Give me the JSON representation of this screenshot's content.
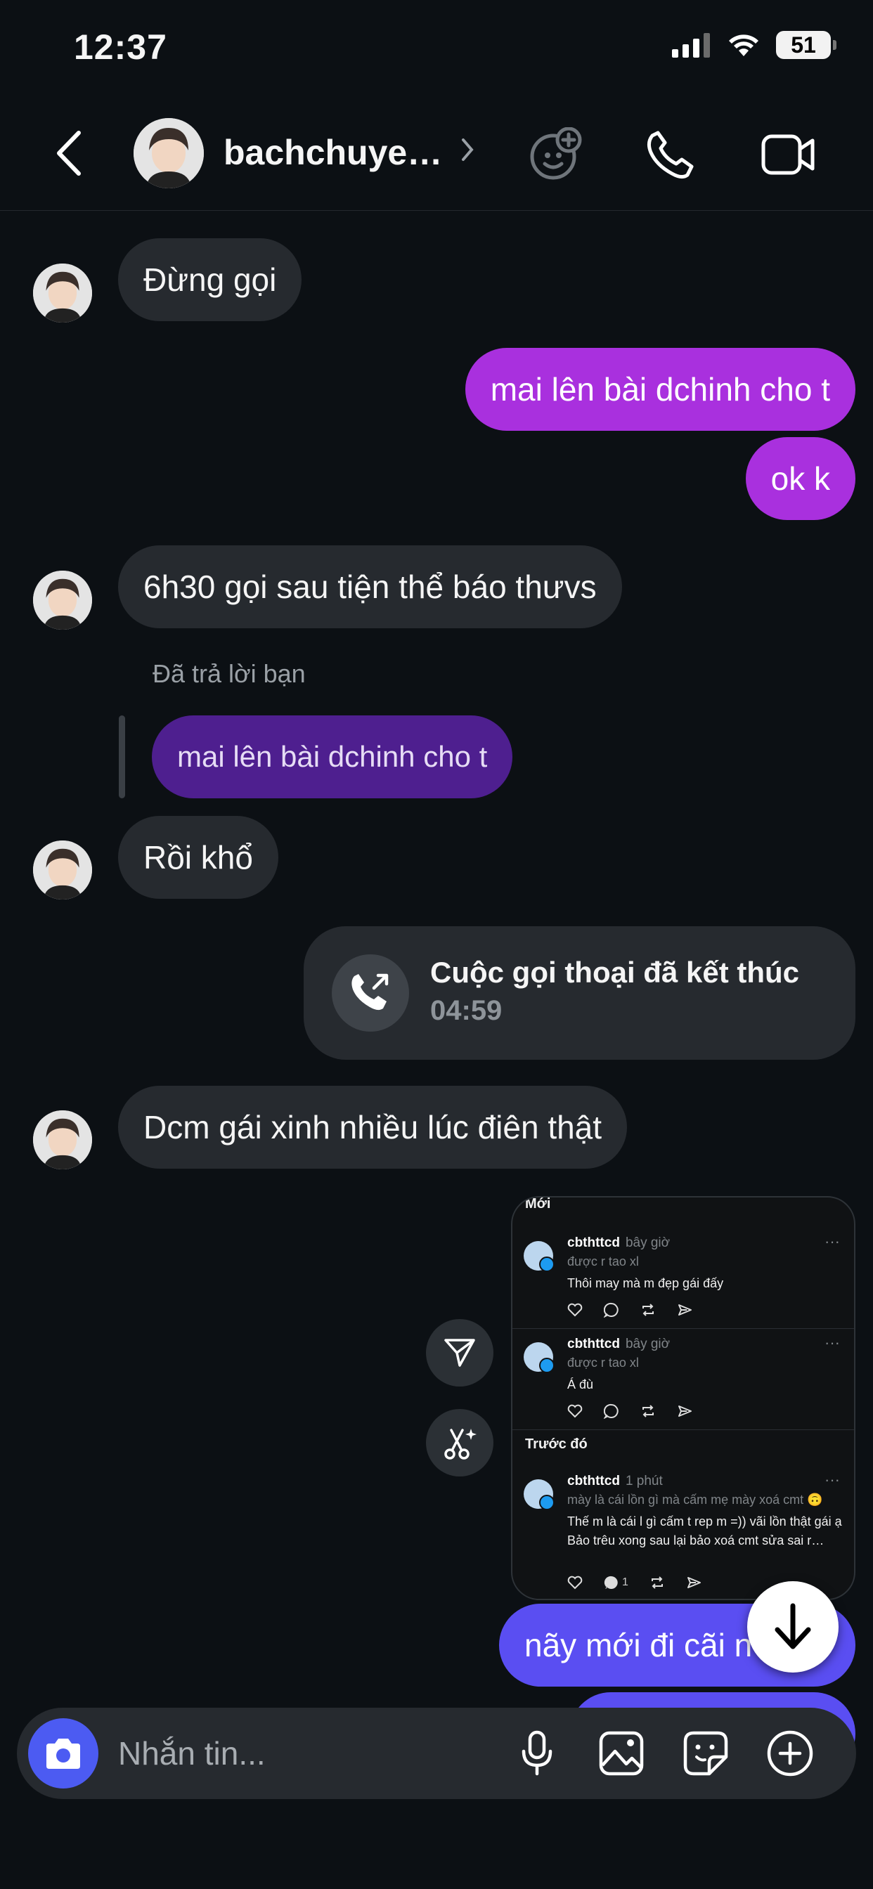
{
  "status_bar": {
    "time": "12:37",
    "battery": "51"
  },
  "header": {
    "name": "bachchuye…"
  },
  "messages": {
    "m1": "Đừng gọi",
    "m2": "mai lên bài dchinh cho t",
    "m3": "ok k",
    "m4": "6h30 gọi sau tiện thể báo thưvs",
    "reply_label": "Đã trả lời bạn",
    "m5_quoted": "mai lên bài dchinh cho t",
    "m6": "Rồi khổ",
    "m8": "Dcm gái xinh nhiều lúc điên thật",
    "m10": "nãy mới đi cãi n"
  },
  "call": {
    "title": "Cuộc gọi thoại đã kết thúc",
    "duration": "04:59"
  },
  "shared_card": {
    "heading_new": "Mới",
    "heading_before": "Trước đó",
    "posts": [
      {
        "user": "cbthttcd",
        "time": "bây giờ",
        "reply_to": "được r tao xl",
        "text": "Thôi may mà m đẹp gái đấy",
        "reply_count": ""
      },
      {
        "user": "cbthttcd",
        "time": "bây giờ",
        "reply_to": "được r tao xl",
        "text": "Á đù",
        "reply_count": ""
      },
      {
        "user": "cbthttcd",
        "time": "1 phút",
        "reply_to": "mày là cái lồn gì mà cấm mẹ mày xoá cmt 🙃",
        "text": "Thế m là cái l gì cấm t rep m =)) vãi lồn thật gái ạ\nBảo trêu xong sau lại bảo xoá cmt sửa sai r…",
        "reply_count": "1"
      }
    ]
  },
  "composer": {
    "placeholder": "Nhắn tin..."
  },
  "colors": {
    "outgoing_purple": "#a930de",
    "outgoing_blue": "#5a4ef2",
    "incoming": "#262a2f",
    "camera_button": "#4c5bf2"
  },
  "icons": {
    "back": "chevron-left-icon",
    "games": "games-plus-icon",
    "call": "phone-icon",
    "video": "video-camera-icon",
    "camera": "camera-icon",
    "mic": "microphone-icon",
    "gallery": "image-icon",
    "sticker": "sticker-icon",
    "more": "plus-circle-icon",
    "send_share": "send-icon",
    "edit_ai": "scissors-sparkle-icon",
    "scroll_down": "arrow-down-icon"
  }
}
